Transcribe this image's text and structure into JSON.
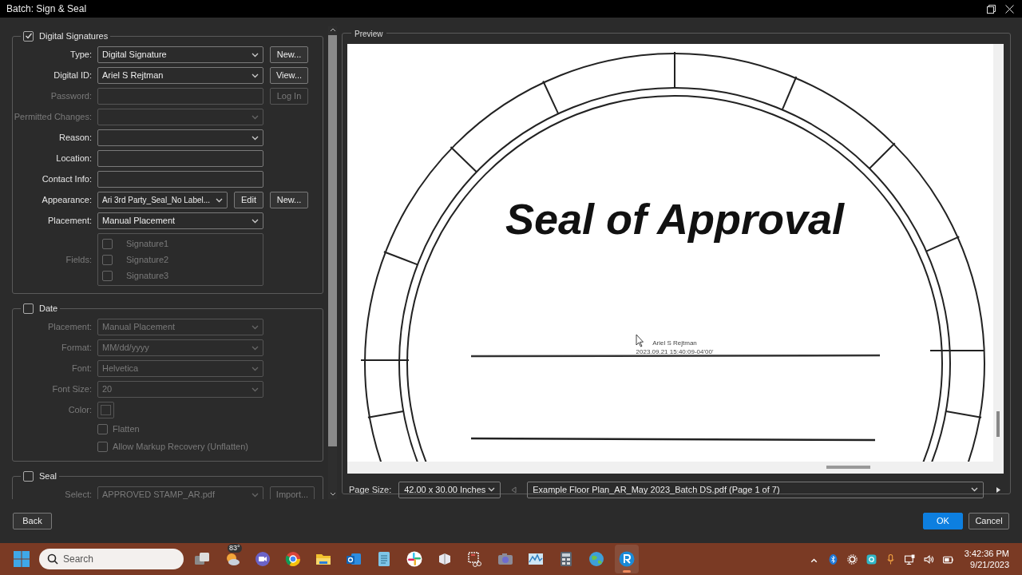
{
  "window": {
    "title": "Batch: Sign & Seal"
  },
  "sections": [
    {
      "title": "Digital Signatures",
      "checked": true,
      "rows": [
        {
          "kind": "dropdown",
          "label": "Type:",
          "value": "Digital Signature",
          "disabled": false,
          "buttons": [
            {
              "label": "New...",
              "disabled": false
            }
          ]
        },
        {
          "kind": "dropdown",
          "label": "Digital ID:",
          "value": "Ariel S Rejtman",
          "disabled": false,
          "buttons": [
            {
              "label": "View...",
              "disabled": false
            }
          ]
        },
        {
          "kind": "text",
          "label": "Password:",
          "disabled": true,
          "buttons": [
            {
              "label": "Log In",
              "disabled": true
            }
          ]
        },
        {
          "kind": "dropdown",
          "label": "Permitted Changes:",
          "disabled": true
        },
        {
          "kind": "dropdown",
          "label": "Reason:",
          "disabled": false
        },
        {
          "kind": "text",
          "label": "Location:",
          "disabled": false
        },
        {
          "kind": "text",
          "label": "Contact Info:",
          "disabled": false
        },
        {
          "kind": "dropdown",
          "label": "Appearance:",
          "value": "Ari 3rd Party_Seal_No Label...",
          "disabled": false,
          "buttons": [
            {
              "label": "Edit",
              "disabled": false
            },
            {
              "label": "New...",
              "disabled": false
            }
          ]
        },
        {
          "kind": "dropdown",
          "label": "Placement:",
          "value": "Manual Placement",
          "disabled": false
        },
        {
          "kind": "checklist",
          "label": "Fields:",
          "disabled": true,
          "items": [
            {
              "label": "Signature1",
              "checked": false
            },
            {
              "label": "Signature2",
              "checked": false
            },
            {
              "label": "Signature3",
              "checked": false
            }
          ]
        }
      ]
    },
    {
      "title": "Date",
      "checked": false,
      "rows": [
        {
          "kind": "dropdown",
          "label": "Placement:",
          "value": "Manual Placement",
          "disabled": true
        },
        {
          "kind": "dropdown",
          "label": "Format:",
          "value": "MM/dd/yyyy",
          "disabled": true
        },
        {
          "kind": "dropdown",
          "label": "Font:",
          "value": "Helvetica",
          "disabled": true
        },
        {
          "kind": "dropdown",
          "label": "Font Size:",
          "value": "20",
          "disabled": true
        },
        {
          "kind": "color",
          "label": "Color:",
          "disabled": true
        },
        {
          "kind": "checkbox",
          "label": "Flatten",
          "checked": false,
          "disabled": true
        },
        {
          "kind": "checkbox",
          "label": "Allow Markup Recovery (Unflatten)",
          "checked": false,
          "disabled": true
        }
      ]
    },
    {
      "title": "Seal",
      "checked": false,
      "rows": [
        {
          "kind": "dropdown",
          "label": "Select:",
          "value": "APPROVED STAMP_AR.pdf",
          "disabled": true,
          "buttons": [
            {
              "label": "Import...",
              "disabled": true
            }
          ]
        }
      ]
    }
  ],
  "preview": {
    "title": "Preview",
    "document": {
      "heading": "Seal of Approval",
      "signer": "Ariel S Rejtman",
      "timestamp": "2023.09.21 15:40:09-04'00'"
    },
    "page_size_label": "Page Size:",
    "page_size": "42.00 x 30.00 Inches",
    "file": "Example Floor Plan_AR_May 2023_Batch DS.pdf (Page 1 of 7)"
  },
  "actions": [
    {
      "label": "Back",
      "kind": "secondary"
    },
    {
      "label": "OK",
      "kind": "primary"
    },
    {
      "label": "Cancel",
      "kind": "secondary"
    }
  ],
  "taskbar": {
    "search_placeholder": "Search",
    "apps": [
      {
        "kind": "task-view",
        "selected": false
      },
      {
        "kind": "weather",
        "badge": "83°",
        "selected": false
      },
      {
        "kind": "meet",
        "selected": false
      },
      {
        "kind": "browser",
        "selected": false
      },
      {
        "kind": "folder",
        "selected": false
      },
      {
        "kind": "mail",
        "selected": false
      },
      {
        "kind": "notepad",
        "selected": false
      },
      {
        "kind": "chat",
        "selected": false
      },
      {
        "kind": "tool",
        "selected": false
      },
      {
        "kind": "snip",
        "selected": false
      },
      {
        "kind": "camera",
        "selected": false
      },
      {
        "kind": "chart",
        "selected": false
      },
      {
        "kind": "calculator",
        "selected": false
      },
      {
        "kind": "globe",
        "selected": false
      },
      {
        "kind": "r-app",
        "selected": true
      }
    ],
    "time": "3:42:36 PM",
    "date": "9/21/2023"
  }
}
